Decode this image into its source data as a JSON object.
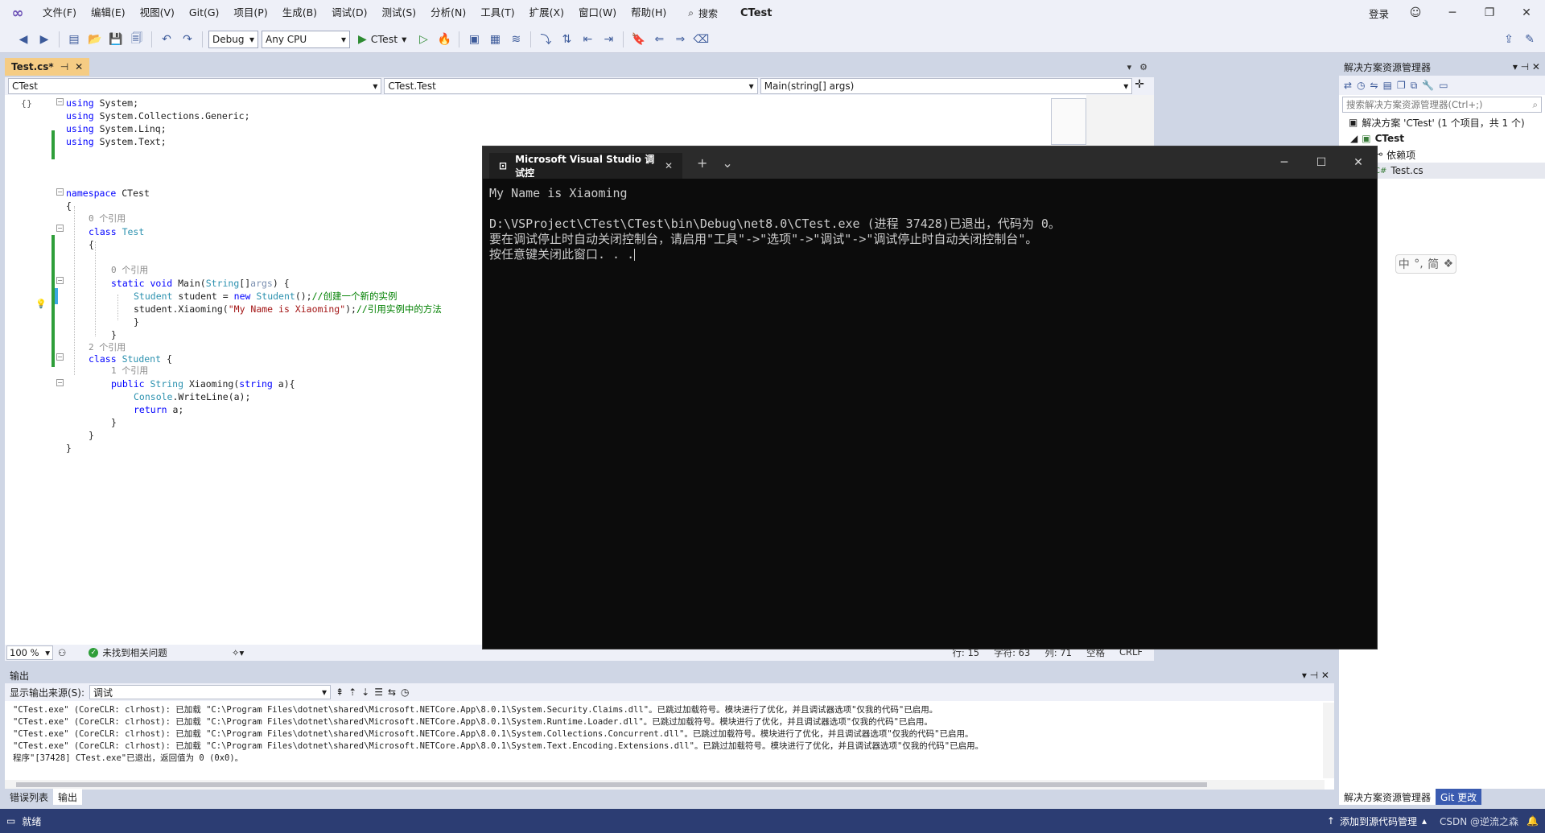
{
  "menubar": {
    "items": [
      "文件(F)",
      "编辑(E)",
      "视图(V)",
      "Git(G)",
      "项目(P)",
      "生成(B)",
      "调试(D)",
      "测试(S)",
      "分析(N)",
      "工具(T)",
      "扩展(X)",
      "窗口(W)",
      "帮助(H)"
    ],
    "search_label": "搜索",
    "app_title": "CTest",
    "signin": "登录"
  },
  "toolbar": {
    "config": "Debug",
    "platform": "Any CPU",
    "run_target": "CTest"
  },
  "document": {
    "tab_title": "Test.cs*",
    "nav_project": "CTest",
    "nav_type": "CTest.Test",
    "nav_member": "Main(string[] args)"
  },
  "code": {
    "l1": "using System;",
    "l2": "using System.Collections.Generic;",
    "l3": "using System.Linq;",
    "l4": "using System.Text;",
    "ns": "CTest",
    "ref0": "0 个引用",
    "ref2": "2 个引用",
    "ref1": "1 个引用",
    "class_test": "Test",
    "class_student": "Student",
    "comment1": "//创建一个新的实例",
    "comment2": "//引用实例中的方法",
    "string_arg": "\"My Name is Xiaoming\"",
    "method": "Xiaoming"
  },
  "editor_status": {
    "zoom": "100 %",
    "issues": "未找到相关问题",
    "line": "行: 15",
    "char": "字符: 63",
    "col": "列: 71",
    "ws": "空格",
    "eol": "CRLF"
  },
  "output": {
    "title": "输出",
    "source_label": "显示输出来源(S):",
    "source_value": "调试",
    "lines": [
      "\"CTest.exe\" (CoreCLR: clrhost): 已加载 \"C:\\Program Files\\dotnet\\shared\\Microsoft.NETCore.App\\8.0.1\\System.Security.Claims.dll\"。已跳过加载符号。模块进行了优化，并且调试器选项\"仅我的代码\"已启用。",
      "\"CTest.exe\" (CoreCLR: clrhost): 已加载 \"C:\\Program Files\\dotnet\\shared\\Microsoft.NETCore.App\\8.0.1\\System.Runtime.Loader.dll\"。已跳过加载符号。模块进行了优化，并且调试器选项\"仅我的代码\"已启用。",
      "\"CTest.exe\" (CoreCLR: clrhost): 已加载 \"C:\\Program Files\\dotnet\\shared\\Microsoft.NETCore.App\\8.0.1\\System.Collections.Concurrent.dll\"。已跳过加载符号。模块进行了优化，并且调试器选项\"仅我的代码\"已启用。",
      "\"CTest.exe\" (CoreCLR: clrhost): 已加载 \"C:\\Program Files\\dotnet\\shared\\Microsoft.NETCore.App\\8.0.1\\System.Text.Encoding.Extensions.dll\"。已跳过加载符号。模块进行了优化，并且调试器选项\"仅我的代码\"已启用。",
      "程序\"[37428] CTest.exe\"已退出，返回值为 0 (0x0)。"
    ]
  },
  "bottom_tabs": {
    "errors": "错误列表",
    "output": "输出"
  },
  "solution": {
    "title": "解决方案资源管理器",
    "search_placeholder": "搜索解决方案资源管理器(Ctrl+;)",
    "root": "解决方案 'CTest' (1 个项目，共 1 个)",
    "project": "CTest",
    "deps": "依赖项",
    "file": "Test.cs",
    "tab_sol": "解决方案资源管理器",
    "tab_git": "Git 更改"
  },
  "ime": {
    "lang": "中",
    "mode": "简"
  },
  "statusbar": {
    "ready": "就绪",
    "add_source": "添加到源代码管理",
    "watermark": "CSDN @逆流之森"
  },
  "console": {
    "tab_title": "Microsoft Visual Studio 调试控",
    "lines": [
      "My Name is Xiaoming",
      "",
      "D:\\VSProject\\CTest\\CTest\\bin\\Debug\\net8.0\\CTest.exe (进程 37428)已退出，代码为 0。",
      "要在调试停止时自动关闭控制台，请启用\"工具\"->\"选项\"->\"调试\"->\"调试停止时自动关闭控制台\"。",
      "按任意键关闭此窗口. . ."
    ]
  }
}
